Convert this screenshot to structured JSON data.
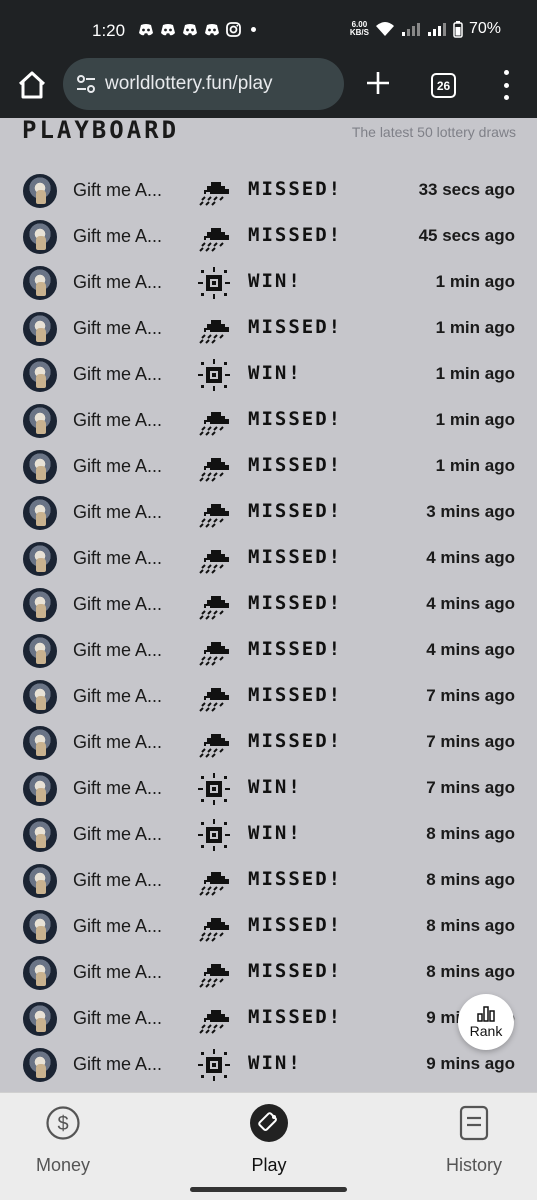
{
  "status_bar": {
    "time": "1:20",
    "net_speed_value": "6.00",
    "net_speed_unit": "KB/S",
    "battery": "70%"
  },
  "browser": {
    "url": "worldlottery.fun/play",
    "tab_count": "26"
  },
  "board": {
    "title": "PLAYBOARD",
    "subtitle": "The latest 50 lottery draws",
    "rows": [
      {
        "name": "Gift me A...",
        "result": "MISSED!",
        "icon": "rain-cloud-icon",
        "time": "33 secs ago"
      },
      {
        "name": "Gift me A...",
        "result": "MISSED!",
        "icon": "rain-cloud-icon",
        "time": "45 secs ago"
      },
      {
        "name": "Gift me A...",
        "result": "WIN!",
        "icon": "sun-icon",
        "time": "1 min ago"
      },
      {
        "name": "Gift me A...",
        "result": "MISSED!",
        "icon": "rain-cloud-icon",
        "time": "1 min ago"
      },
      {
        "name": "Gift me A...",
        "result": "WIN!",
        "icon": "sun-icon",
        "time": "1 min ago"
      },
      {
        "name": "Gift me A...",
        "result": "MISSED!",
        "icon": "rain-cloud-icon",
        "time": "1 min ago"
      },
      {
        "name": "Gift me A...",
        "result": "MISSED!",
        "icon": "rain-cloud-icon",
        "time": "1 min ago"
      },
      {
        "name": "Gift me A...",
        "result": "MISSED!",
        "icon": "rain-cloud-icon",
        "time": "3 mins ago"
      },
      {
        "name": "Gift me A...",
        "result": "MISSED!",
        "icon": "rain-cloud-icon",
        "time": "4 mins ago"
      },
      {
        "name": "Gift me A...",
        "result": "MISSED!",
        "icon": "rain-cloud-icon",
        "time": "4 mins ago"
      },
      {
        "name": "Gift me A...",
        "result": "MISSED!",
        "icon": "rain-cloud-icon",
        "time": "4 mins ago"
      },
      {
        "name": "Gift me A...",
        "result": "MISSED!",
        "icon": "rain-cloud-icon",
        "time": "7 mins ago"
      },
      {
        "name": "Gift me A...",
        "result": "MISSED!",
        "icon": "rain-cloud-icon",
        "time": "7 mins ago"
      },
      {
        "name": "Gift me A...",
        "result": "WIN!",
        "icon": "sun-icon",
        "time": "7 mins ago"
      },
      {
        "name": "Gift me A...",
        "result": "WIN!",
        "icon": "sun-icon",
        "time": "8 mins ago"
      },
      {
        "name": "Gift me A...",
        "result": "MISSED!",
        "icon": "rain-cloud-icon",
        "time": "8 mins ago"
      },
      {
        "name": "Gift me A...",
        "result": "MISSED!",
        "icon": "rain-cloud-icon",
        "time": "8 mins ago"
      },
      {
        "name": "Gift me A...",
        "result": "MISSED!",
        "icon": "rain-cloud-icon",
        "time": "8 mins ago"
      },
      {
        "name": "Gift me A...",
        "result": "MISSED!",
        "icon": "rain-cloud-icon",
        "time": "9 mins ago"
      },
      {
        "name": "Gift me A...",
        "result": "WIN!",
        "icon": "sun-icon",
        "time": "9 mins ago"
      }
    ]
  },
  "rank_button": {
    "label": "Rank",
    "icon": "bar-chart-icon"
  },
  "nav": {
    "money": {
      "label": "Money",
      "icon": "dollar-circle-icon"
    },
    "play": {
      "label": "Play",
      "icon": "play-ticket-icon"
    },
    "history": {
      "label": "History",
      "icon": "document-icon"
    }
  },
  "colors": {
    "background": "#c6c6cb",
    "browser_chrome": "#1f2224",
    "url_box": "#3a4548",
    "nav_background": "#ececec"
  }
}
